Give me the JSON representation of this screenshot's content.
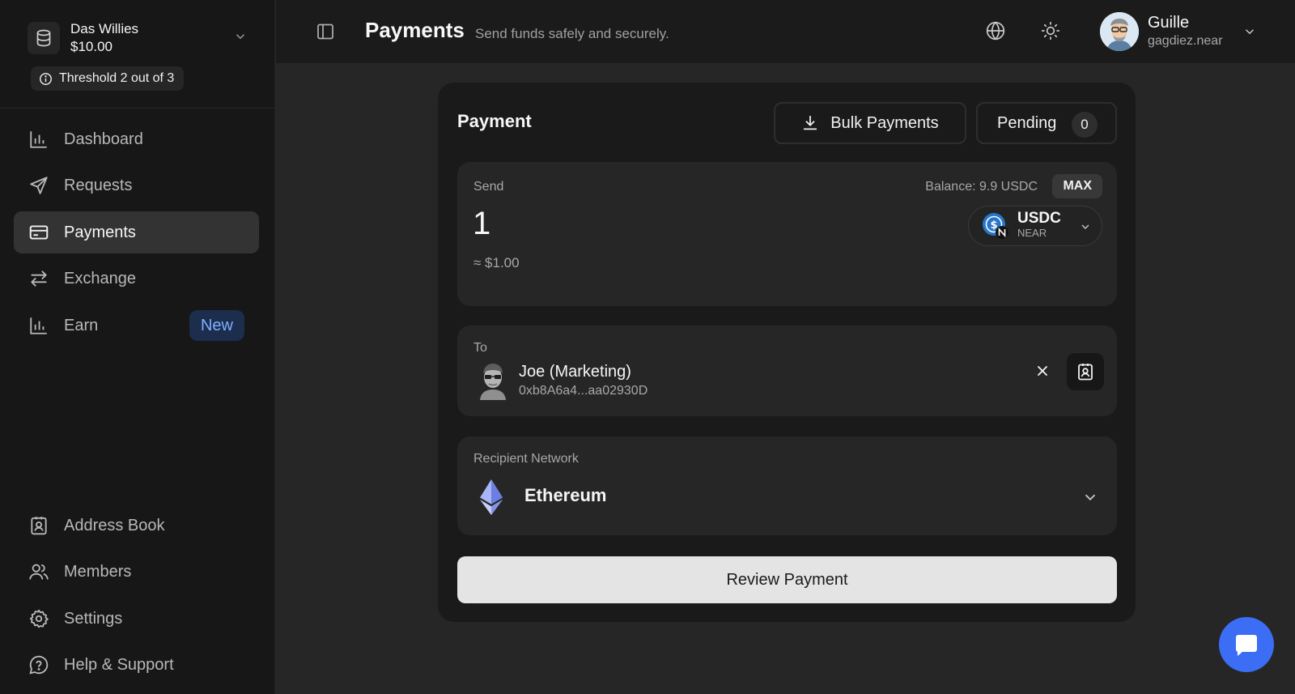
{
  "sidebar": {
    "treasury": {
      "name": "Das Willies",
      "balance": "$10.00"
    },
    "threshold": "Threshold 2 out of 3",
    "nav": [
      {
        "label": "Dashboard",
        "icon": "bar-chart-icon"
      },
      {
        "label": "Requests",
        "icon": "send-icon"
      },
      {
        "label": "Payments",
        "icon": "credit-card-icon",
        "active": true
      },
      {
        "label": "Exchange",
        "icon": "arrows-swap-icon"
      },
      {
        "label": "Earn",
        "icon": "bar-chart-icon",
        "badge": "New"
      }
    ],
    "bottom_nav": [
      {
        "label": "Address Book",
        "icon": "contact-book-icon"
      },
      {
        "label": "Members",
        "icon": "users-icon"
      },
      {
        "label": "Settings",
        "icon": "gear-icon"
      },
      {
        "label": "Help & Support",
        "icon": "help-circle-icon"
      }
    ]
  },
  "header": {
    "title": "Payments",
    "subtitle": "Send funds safely and securely.",
    "user": {
      "name": "Guille",
      "account": "gagdiez.near"
    }
  },
  "payment": {
    "title": "Payment",
    "bulk_label": "Bulk Payments",
    "pending_label": "Pending",
    "pending_count": "0",
    "send": {
      "label": "Send",
      "amount": "1",
      "usd_value": "≈ $1.00",
      "balance": "Balance: 9.9 USDC",
      "max_label": "MAX",
      "token_symbol": "USDC",
      "token_network": "NEAR"
    },
    "to": {
      "label": "To",
      "name": "Joe (Marketing)",
      "address": "0xb8A6a4...aa02930D"
    },
    "network": {
      "label": "Recipient Network",
      "name": "Ethereum"
    },
    "review_label": "Review Payment"
  },
  "colors": {
    "accent": "#3b6ef5",
    "badge_bg": "#1c2d4e",
    "badge_text": "#7fb0ff"
  }
}
